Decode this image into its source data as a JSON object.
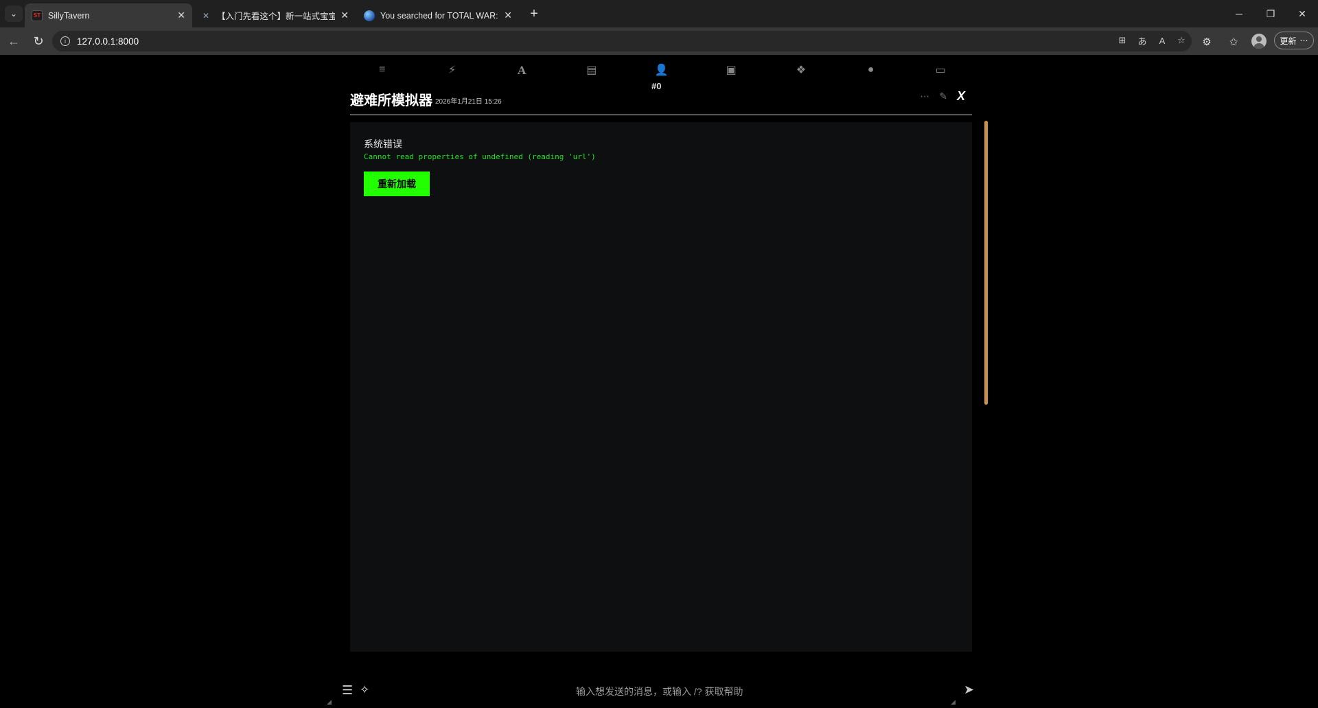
{
  "browser": {
    "tabs": [
      {
        "title": "SillyTavern",
        "favicon": "ST",
        "active": true
      },
      {
        "title": "【入门先看这个】新一站式宝宝教",
        "favicon": "bird-icon",
        "active": false
      },
      {
        "title": "You searched for TOTAL WAR:THRE",
        "favicon": "globe-icon",
        "active": false
      }
    ],
    "url": "127.0.0.1:8000",
    "update_label": "更新"
  },
  "app": {
    "nav_icons": [
      "sliders-icon",
      "plug-icon",
      "font-icon",
      "book-icon",
      "user-gear-icon",
      "image-icon",
      "cubes-icon",
      "face-icon",
      "id-card-icon"
    ],
    "message_id": "#0",
    "message": {
      "char_name": "避难所模拟器",
      "timestamp": "2026年1月21日 15:26"
    },
    "error": {
      "title": "系统错误",
      "detail": "Cannot read properties of undefined (reading 'url')",
      "reload_label": "重新加载"
    },
    "input": {
      "placeholder": "输入想发送的消息，或输入 /? 获取帮助"
    },
    "accent_color": "#22ff00",
    "scrollbar_color": "#c9914d"
  }
}
